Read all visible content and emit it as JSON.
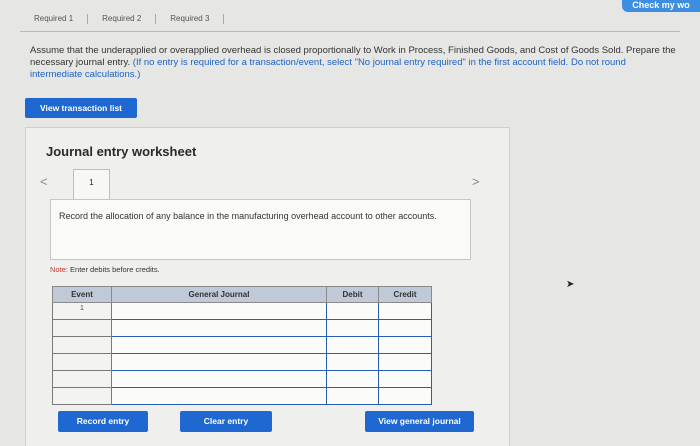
{
  "tabs": [
    "Required 1",
    "Required 2",
    "Required 3"
  ],
  "check_button": "Check my wo",
  "instructions": {
    "main": "Assume that the underapplied or overapplied overhead is closed proportionally to Work in Process, Finished Goods, and Cost of Goods Sold. Prepare the necessary journal entry.",
    "hint": "(If no entry is required for a transaction/event, select \"No journal entry required\" in the first account field. Do not round intermediate calculations.)"
  },
  "view_transaction_list": "View transaction list",
  "worksheet": {
    "title": "Journal entry worksheet",
    "prev": "<",
    "next": ">",
    "page": "1",
    "description": "Record the allocation of any balance in the manufacturing overhead account to other accounts.",
    "note_label": "Note:",
    "note_text": " Enter debits before credits."
  },
  "table": {
    "headers": {
      "event": "Event",
      "journal": "General Journal",
      "debit": "Debit",
      "credit": "Credit"
    },
    "first_event": "1"
  },
  "buttons": {
    "record": "Record entry",
    "clear": "Clear entry",
    "view_journal": "View general journal"
  }
}
